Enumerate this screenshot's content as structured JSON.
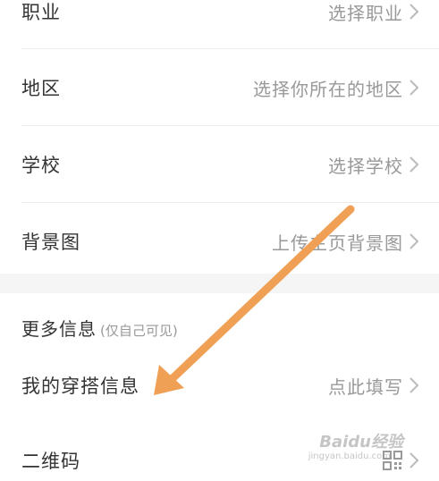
{
  "rows": {
    "occupation": {
      "label": "职业",
      "value": "选择职业"
    },
    "region": {
      "label": "地区",
      "value": "选择你所在的地区"
    },
    "school": {
      "label": "学校",
      "value": "选择学校"
    },
    "background": {
      "label": "背景图",
      "value": "上传主页背景图"
    }
  },
  "more_info": {
    "title": "更多信息",
    "note": "(仅自己可见)",
    "outfit": {
      "label": "我的穿搭信息",
      "value": "点此填写"
    },
    "qrcode": {
      "label": "二维码"
    }
  },
  "annotation": {
    "color": "#f0a055"
  },
  "watermark": {
    "text": "Baidu经验",
    "sub": "jingyan.baidu.com"
  },
  "icons": {
    "chevron": "chevron-right-icon",
    "qrcode": "qr-code-icon"
  }
}
